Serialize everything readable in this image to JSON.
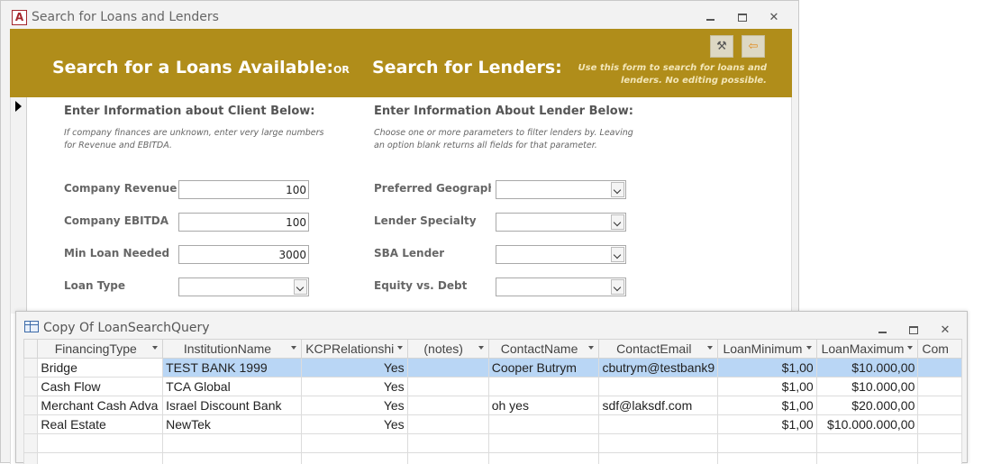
{
  "form_window": {
    "title": "Search for Loans and Lenders",
    "app_icon_letter": "A",
    "banner": {
      "title_loans": "Search for a Loans Available:",
      "or_label": "OR",
      "title_lenders": "Search for Lenders:",
      "note": "Use this form to search for loans and lenders.  No editing possible.",
      "settings_icon": "tools-icon",
      "exit_icon": "exit-icon"
    },
    "client_section": {
      "heading": "Enter Information about Client Below:",
      "note": "If company finances are unknown, enter very large numbers for Revenue and EBITDA.",
      "fields": [
        {
          "label": "Company Revenue",
          "value": "100"
        },
        {
          "label": "Company EBITDA",
          "value": "100"
        },
        {
          "label": "Min Loan Needed",
          "value": "3000"
        },
        {
          "label": "Loan Type",
          "value": ""
        }
      ]
    },
    "lender_section": {
      "heading": "Enter Information About Lender Below:",
      "note": "Choose one or more parameters to filter lenders by. Leaving an option blank returns all fields for that parameter.",
      "fields": [
        {
          "label": "Preferred Geography",
          "value": ""
        },
        {
          "label": "Lender Specialty",
          "value": ""
        },
        {
          "label": "SBA Lender",
          "value": ""
        },
        {
          "label": "Equity vs. Debt",
          "value": ""
        }
      ]
    }
  },
  "datasheet": {
    "title": "Copy Of LoanSearchQuery",
    "columns": [
      "FinancingType",
      "InstitutionName",
      "KCPRelationshi",
      "(notes)",
      "ContactName",
      "ContactEmail",
      "LoanMinimum",
      "LoanMaximum",
      "Com"
    ],
    "rows": [
      [
        "Bridge",
        "TEST BANK 1999",
        "Yes",
        "",
        "Cooper Butrym",
        "cbutrym@testbank9",
        "$1,00",
        "$10.000,00",
        ""
      ],
      [
        "Cash Flow",
        "TCA Global",
        "Yes",
        "",
        "",
        "",
        "$1,00",
        "$10.000,00",
        ""
      ],
      [
        "Merchant Cash Adva",
        "Israel Discount Bank",
        "Yes",
        "",
        "oh yes",
        "sdf@laksdf.com",
        "$1,00",
        "$20.000,00",
        ""
      ],
      [
        "Real Estate",
        "NewTek",
        "Yes",
        "",
        "",
        "",
        "$1,00",
        "$10.000.000,00",
        ""
      ]
    ],
    "selected_row": 0
  }
}
